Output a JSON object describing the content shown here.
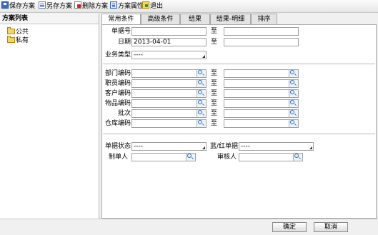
{
  "toolbar": {
    "items": [
      {
        "label": "保存方案",
        "icon": "save-icon"
      },
      {
        "label": "另存方案",
        "icon": "save-as-icon"
      },
      {
        "label": "删除方案",
        "icon": "delete-icon"
      },
      {
        "label": "方案属性",
        "icon": "properties-icon"
      },
      {
        "label": "退出",
        "icon": "exit-icon"
      }
    ]
  },
  "sidebar": {
    "title": "方案列表",
    "items": [
      {
        "label": "公共"
      },
      {
        "label": "私有"
      }
    ]
  },
  "tabs": [
    {
      "label": "常用条件",
      "active": true
    },
    {
      "label": "高级条件",
      "active": false
    },
    {
      "label": "结果",
      "active": false
    },
    {
      "label": "结果-明细",
      "active": false
    },
    {
      "label": "排序",
      "active": false
    }
  ],
  "form": {
    "bill_no": {
      "label": "单据号",
      "from": "",
      "to_label": "至",
      "to": ""
    },
    "date": {
      "label": "日期",
      "from": "2013-04-01",
      "to_label": "至",
      "to": ""
    },
    "business_type": {
      "label": "业务类型",
      "value": "----"
    },
    "department_code": {
      "label": "部门编码",
      "from": "",
      "to_label": "至",
      "to": ""
    },
    "staff_code": {
      "label": "职员编码",
      "from": "",
      "to_label": "至",
      "to": ""
    },
    "customer_code": {
      "label": "客户编码",
      "from": "",
      "to_label": "至",
      "to": ""
    },
    "item_code": {
      "label": "物品编码",
      "from": "",
      "to_label": "至",
      "to": ""
    },
    "batch": {
      "label": "批次",
      "from": "",
      "to_label": "至",
      "to": ""
    },
    "warehouse_code": {
      "label": "仓库编码",
      "from": "",
      "to_label": "至",
      "to": ""
    },
    "bill_status": {
      "label": "单据状态",
      "value": "----"
    },
    "red_blue": {
      "label": "蓝/红单据",
      "value": "----"
    },
    "creator": {
      "label": "制单人",
      "value": ""
    },
    "reviewer": {
      "label": "审核人",
      "value": ""
    }
  },
  "buttons": {
    "ok": "确定",
    "cancel": "取消"
  }
}
